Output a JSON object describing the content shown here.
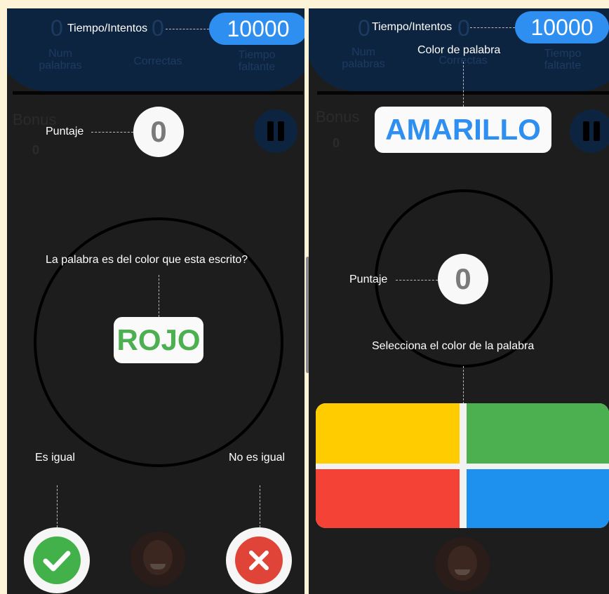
{
  "left": {
    "faded_top": {
      "num_value": "0",
      "num_label": "Num palabras",
      "correct_label": "Correctas",
      "correct_value": "0",
      "time_label": "Tiempo faltante"
    },
    "tiempo_label": "Tiempo/Intentos",
    "tiempo_value": "10000",
    "bonus_label": "Bonus",
    "bonus_value": "0",
    "puntaje_label": "Puntaje",
    "puntaje_value": "0",
    "question": "La palabra es del color que esta escrito?",
    "word": "ROJO",
    "word_color": "#4caf50",
    "es_igual": "Es igual",
    "no_es_igual": "No es igual"
  },
  "right": {
    "faded_top": {
      "num_value": "0",
      "num_label": "Num palabras",
      "correct_label": "Correctas",
      "correct_value": "0",
      "time_label": "Tiempo faltante"
    },
    "tiempo_label": "Tiempo/Intentos",
    "tiempo_value": "10000",
    "color_label": "Color de palabra",
    "bonus_label": "Bonus",
    "bonus_value": "0",
    "word": "AMARILLO",
    "word_color": "#2e8ff0",
    "puntaje_label": "Puntaje",
    "puntaje_value": "0",
    "select_label": "Selecciona el color de la palabra",
    "tiles": [
      "yellow",
      "green",
      "red",
      "blue"
    ]
  },
  "colors": {
    "yellow": "#ffcc00",
    "green": "#4caf50",
    "red": "#f44336",
    "blue": "#1e90ee",
    "blue_pill": "#2e8ff0"
  },
  "icons": [
    "check-icon",
    "close-icon",
    "pause-icon",
    "avatar-icon"
  ]
}
